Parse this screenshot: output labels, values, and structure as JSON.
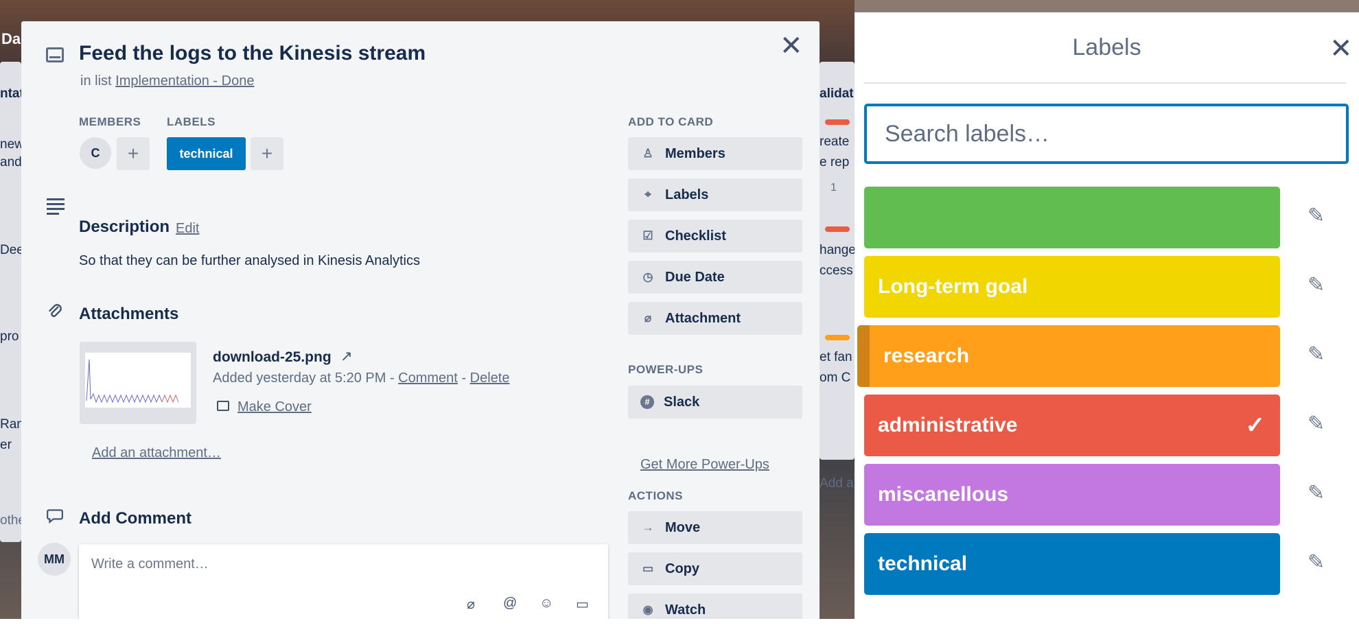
{
  "card": {
    "title": "Feed the logs to the Kinesis stream",
    "in_list_prefix": "in list",
    "list_name": "Implementation - Done"
  },
  "members": {
    "header": "MEMBERS",
    "avatar": "C",
    "add": "+"
  },
  "labels_section": {
    "header": "LABELS",
    "chip": "technical",
    "add": "+"
  },
  "description": {
    "title": "Description",
    "edit": "Edit",
    "text": "So that they can be further analysed in Kinesis Analytics"
  },
  "attachments": {
    "title": "Attachments",
    "file_name": "download-25.png",
    "added_text": "Added yesterday at 5:20 PM - ",
    "comment_link": "Comment",
    "separator": " - ",
    "delete_link": "Delete",
    "make_cover": "Make Cover",
    "add_attachment": "Add an attachment…"
  },
  "comment": {
    "title": "Add Comment",
    "avatar": "MM",
    "placeholder": "Write a comment…"
  },
  "sidebar": {
    "add_to_card": "ADD TO CARD",
    "buttons": [
      {
        "label": "Members",
        "icon": "person-icon"
      },
      {
        "label": "Labels",
        "icon": "tag-icon"
      },
      {
        "label": "Checklist",
        "icon": "checkbox-icon"
      },
      {
        "label": "Due Date",
        "icon": "clock-icon"
      },
      {
        "label": "Attachment",
        "icon": "paperclip-icon"
      }
    ],
    "power_ups": "POWER-UPS",
    "slack": "Slack",
    "more_power_ups": "Get More Power-Ups",
    "actions": "ACTIONS",
    "action_buttons": [
      {
        "label": "Move",
        "icon": "arrow-right-icon"
      },
      {
        "label": "Copy",
        "icon": "card-icon"
      },
      {
        "label": "Watch",
        "icon": "eye-icon"
      }
    ]
  },
  "labels_popover": {
    "title": "Labels",
    "search_placeholder": "Search labels…",
    "labels": [
      {
        "name": "",
        "color": "#61bd4f",
        "checked": false
      },
      {
        "name": "Long-term goal",
        "color": "#f2d600",
        "checked": false
      },
      {
        "name": "research",
        "color": "#ff9f1a",
        "checked": false
      },
      {
        "name": "administrative",
        "color": "#eb5a46",
        "checked": true
      },
      {
        "name": "miscanellous",
        "color": "#c377e0",
        "checked": false
      },
      {
        "name": "technical",
        "color": "#0079bf",
        "checked": false
      }
    ]
  },
  "background": {
    "fragments": [
      "Da",
      "ntat",
      "new",
      "and",
      "Dee",
      "pro",
      "Ran",
      "er",
      "othe",
      "alidat",
      "reate",
      "e rep",
      "1",
      "hange",
      "ccess",
      "et fan",
      "om C",
      "Add a"
    ]
  }
}
